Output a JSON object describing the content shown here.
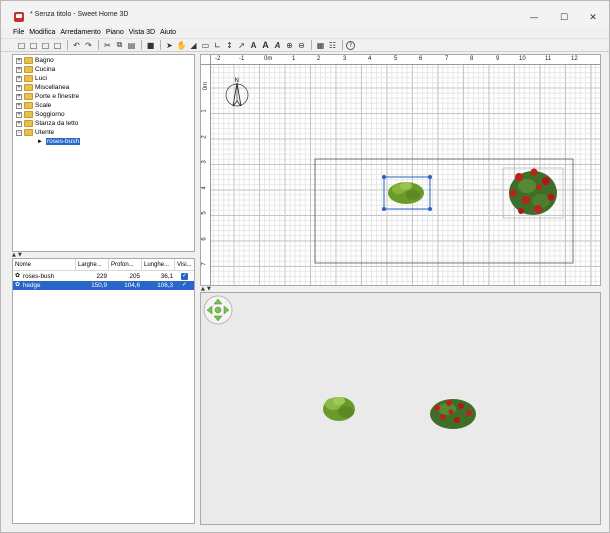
{
  "window": {
    "title": "* Senza titolo - Sweet Home 3D",
    "minimize_glyph": "—",
    "maximize_glyph": "☐",
    "close_glyph": "✕"
  },
  "menu": [
    "File",
    "Modifica",
    "Arredamento",
    "Piano",
    "Vista 3D",
    "Aiuto"
  ],
  "toolbar": {
    "icons": [
      "new-home-icon",
      "open-icon",
      "save-icon",
      "save-as-icon",
      "undo-icon",
      "redo-icon",
      "cut-icon",
      "copy-icon",
      "paste-icon",
      "add-furniture-icon",
      "select-icon",
      "pan-icon",
      "create-walls-icon",
      "create-rooms-icon",
      "create-polylines-icon",
      "create-dimensions-icon",
      "add-text-icon",
      "zoom-in-icon",
      "zoom-out-icon",
      "import-icon",
      "preferences-icon",
      "help-icon"
    ],
    "text_buttons": [
      "A",
      "A",
      "A"
    ],
    "help_label": "?"
  },
  "catalog": {
    "categories": [
      "Bagno",
      "Cucina",
      "Luci",
      "Miscellanea",
      "Porte e finestre",
      "Scale",
      "Soggiorno",
      "Stanza da letto",
      "Utente"
    ],
    "expanded_child": "roses-bush",
    "collapsed_glyph": "+",
    "expanded_glyph": "−"
  },
  "furniture_table": {
    "columns": [
      "Nome",
      "Larghe...",
      "Profon...",
      "Lunghe...",
      "Visi..."
    ],
    "rows": [
      {
        "name": "roses-bush",
        "width": "229",
        "depth": "205",
        "height": "36,1",
        "visible": true,
        "selected": false
      },
      {
        "name": "hedge",
        "width": "150,9",
        "depth": "104,6",
        "height": "106,3",
        "visible": true,
        "selected": true
      }
    ],
    "check_glyph": "✓"
  },
  "plan": {
    "ruler_x_labels": [
      "-2",
      "-1",
      "0m",
      "1",
      "2",
      "3",
      "4",
      "5",
      "6",
      "7",
      "8",
      "9",
      "10",
      "11",
      "12"
    ],
    "ruler_y_labels": [
      "0m",
      "1",
      "2",
      "3",
      "4",
      "5",
      "6",
      "7"
    ],
    "compass_label": "N"
  },
  "splitter": {
    "up_glyph": "▲",
    "down_glyph": "▼"
  },
  "colors": {
    "selection": "#2867c7",
    "folder": "#e8c050",
    "grid_major": "#c6c6c6",
    "grid_minor": "#e6e6e6",
    "view_background": "#eaeaea",
    "bush_green": "#6a9a2a",
    "rose_red": "#c0201c"
  }
}
